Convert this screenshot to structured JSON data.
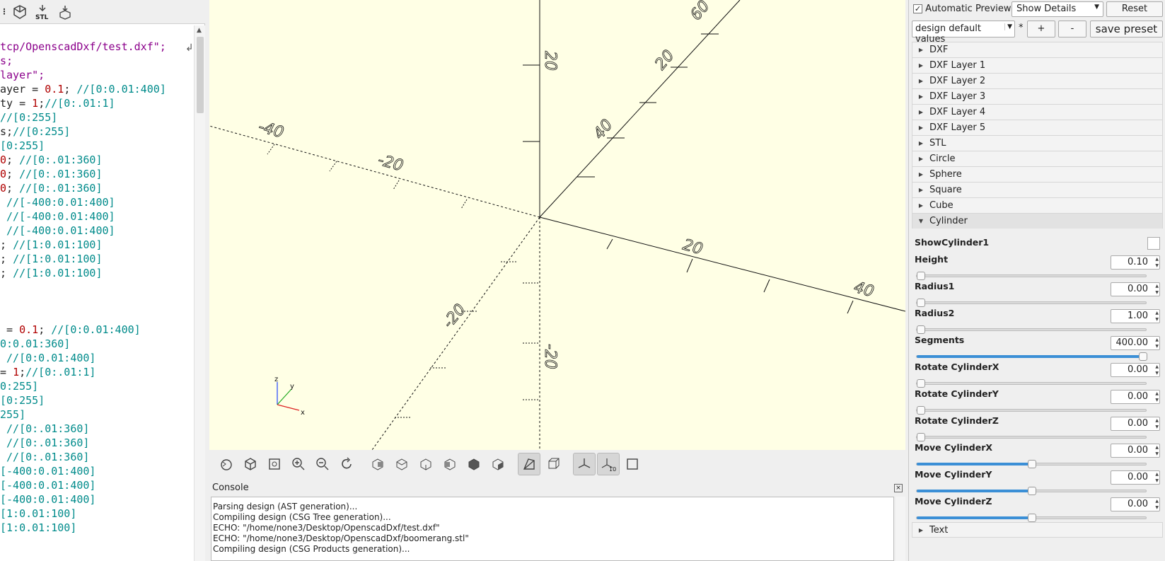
{
  "editor": {
    "toolbar": {
      "icons": [
        "menu-edge-icon",
        "render-icon",
        "export-stl-icon",
        "send-to-print-icon"
      ],
      "stl_label": "STL"
    },
    "lines": [
      [],
      [
        {
          "t": "tcp/OpenscadDxf/test.dxf\";",
          "c": "str"
        }
      ],
      [
        {
          "t": "s;",
          "c": "str"
        }
      ],
      [
        {
          "t": "layer\";",
          "c": "str"
        }
      ],
      [
        {
          "t": "ayer = ",
          "c": "plain"
        },
        {
          "t": "0.1",
          "c": "num"
        },
        {
          "t": "; ",
          "c": "plain"
        },
        {
          "t": "//[0:0.01:400]",
          "c": "cmt"
        }
      ],
      [
        {
          "t": "ty = ",
          "c": "plain"
        },
        {
          "t": "1",
          "c": "num"
        },
        {
          "t": ";",
          "c": "plain"
        },
        {
          "t": "//[0:.01:1]",
          "c": "cmt"
        }
      ],
      [
        {
          "t": "//[0:255]",
          "c": "cmt"
        }
      ],
      [
        {
          "t": "s;",
          "c": "plain"
        },
        {
          "t": "//[0:255]",
          "c": "cmt"
        }
      ],
      [
        {
          "t": "[0:255]",
          "c": "cmt"
        }
      ],
      [
        {
          "t": "0",
          "c": "num"
        },
        {
          "t": "; ",
          "c": "plain"
        },
        {
          "t": "//[0:.01:360]",
          "c": "cmt"
        }
      ],
      [
        {
          "t": "0",
          "c": "num"
        },
        {
          "t": "; ",
          "c": "plain"
        },
        {
          "t": "//[0:.01:360]",
          "c": "cmt"
        }
      ],
      [
        {
          "t": "0",
          "c": "num"
        },
        {
          "t": "; ",
          "c": "plain"
        },
        {
          "t": "//[0:.01:360]",
          "c": "cmt"
        }
      ],
      [
        {
          "t": " //[-400:0.01:400]",
          "c": "cmt"
        }
      ],
      [
        {
          "t": " //[-400:0.01:400]",
          "c": "cmt"
        }
      ],
      [
        {
          "t": " //[-400:0.01:400]",
          "c": "cmt"
        }
      ],
      [
        {
          "t": "; ",
          "c": "plain"
        },
        {
          "t": "//[1:0.01:100]",
          "c": "cmt"
        }
      ],
      [
        {
          "t": "; ",
          "c": "plain"
        },
        {
          "t": "//[1:0.01:100]",
          "c": "cmt"
        }
      ],
      [
        {
          "t": "; ",
          "c": "plain"
        },
        {
          "t": "//[1:0.01:100]",
          "c": "cmt"
        }
      ],
      [],
      [],
      [],
      [
        {
          "t": " = ",
          "c": "plain"
        },
        {
          "t": "0.1",
          "c": "num"
        },
        {
          "t": "; ",
          "c": "plain"
        },
        {
          "t": "//[0:0.01:400]",
          "c": "cmt"
        }
      ],
      [
        {
          "t": "0:0.01:360]",
          "c": "cmt"
        }
      ],
      [
        {
          "t": " //[0:0.01:400]",
          "c": "cmt"
        }
      ],
      [
        {
          "t": "= ",
          "c": "plain"
        },
        {
          "t": "1",
          "c": "num"
        },
        {
          "t": ";",
          "c": "plain"
        },
        {
          "t": "//[0:.01:1]",
          "c": "cmt"
        }
      ],
      [
        {
          "t": "0:255]",
          "c": "cmt"
        }
      ],
      [
        {
          "t": "[0:255]",
          "c": "cmt"
        }
      ],
      [
        {
          "t": "255]",
          "c": "cmt"
        }
      ],
      [
        {
          "t": " //[0:.01:360]",
          "c": "cmt"
        }
      ],
      [
        {
          "t": " //[0:.01:360]",
          "c": "cmt"
        }
      ],
      [
        {
          "t": " //[0:.01:360]",
          "c": "cmt"
        }
      ],
      [
        {
          "t": "[-400:0.01:400]",
          "c": "cmt"
        }
      ],
      [
        {
          "t": "[-400:0.01:400]",
          "c": "cmt"
        }
      ],
      [
        {
          "t": "[-400:0.01:400]",
          "c": "cmt"
        }
      ],
      [
        {
          "t": "[1:0.01:100]",
          "c": "cmt"
        }
      ],
      [
        {
          "t": "[1:0.01:100]",
          "c": "cmt"
        }
      ]
    ]
  },
  "viewport": {
    "axis_labels": [
      "20",
      "40",
      "-40",
      "-20",
      "20",
      "40",
      "20",
      "-20",
      "-20",
      "60"
    ],
    "orientation_axes": [
      "z",
      "y",
      "x"
    ]
  },
  "view_toolbar": {
    "icons": [
      "preview-icon",
      "render-icon",
      "view-all-icon",
      "zoom-in-icon",
      "zoom-out-icon",
      "reset-view-icon",
      "view-right-icon",
      "view-top-icon",
      "view-bottom-icon",
      "view-left-icon",
      "view-front-icon",
      "view-back-icon",
      "perspective-icon",
      "orthogonal-icon",
      "show-axes-icon",
      "show-scale-icon",
      "show-edges-icon"
    ],
    "scale_marker": "10"
  },
  "console": {
    "title": "Console",
    "lines": [
      "Parsing design (AST generation)...",
      "Compiling design (CSG Tree generation)...",
      "ECHO: \"/home/none3/Desktop/OpenscadDxf/test.dxf\"",
      "ECHO: \"/home/none3/Desktop/OpenscadDxf/boomerang.stl\"",
      "Compiling design (CSG Products generation)..."
    ]
  },
  "customizer": {
    "auto_preview_label": "Automatic Preview",
    "auto_preview_checked": "✓",
    "details_select": "Show Details",
    "reset_label": "Reset",
    "preset_select": "design default values",
    "preset_modified": "*",
    "plus_label": "+",
    "minus_label": "-",
    "save_preset_label": "save preset",
    "groups": [
      "DXF",
      "DXF Layer 1",
      "DXF Layer 2",
      "DXF Layer 3",
      "DXF Layer 4",
      "DXF Layer 5",
      "STL",
      "Circle",
      "Sphere",
      "Square",
      "Cube",
      "Cylinder"
    ],
    "open_group": "Cylinder",
    "show_cylinder_label": "ShowCylinder1",
    "params": [
      {
        "name": "Height",
        "value": "0.10",
        "level": 0.0
      },
      {
        "name": "Radius1",
        "value": "0.00",
        "level": 0.0
      },
      {
        "name": "Radius2",
        "value": "1.00",
        "level": 0.0
      },
      {
        "name": "Segments",
        "value": "400.00",
        "level": 1.0
      },
      {
        "name": "Rotate CylinderX",
        "value": "0.00",
        "level": 0.0
      },
      {
        "name": "Rotate CylinderY",
        "value": "0.00",
        "level": 0.0
      },
      {
        "name": "Rotate CylinderZ",
        "value": "0.00",
        "level": 0.0
      },
      {
        "name": "Move CylinderX",
        "value": "0.00",
        "level": 0.5
      },
      {
        "name": "Move CylinderY",
        "value": "0.00",
        "level": 0.5
      },
      {
        "name": "Move CylinderZ",
        "value": "0.00",
        "level": 0.5
      }
    ],
    "trailing_group": "Text",
    "accent": "#3b8fd6"
  }
}
